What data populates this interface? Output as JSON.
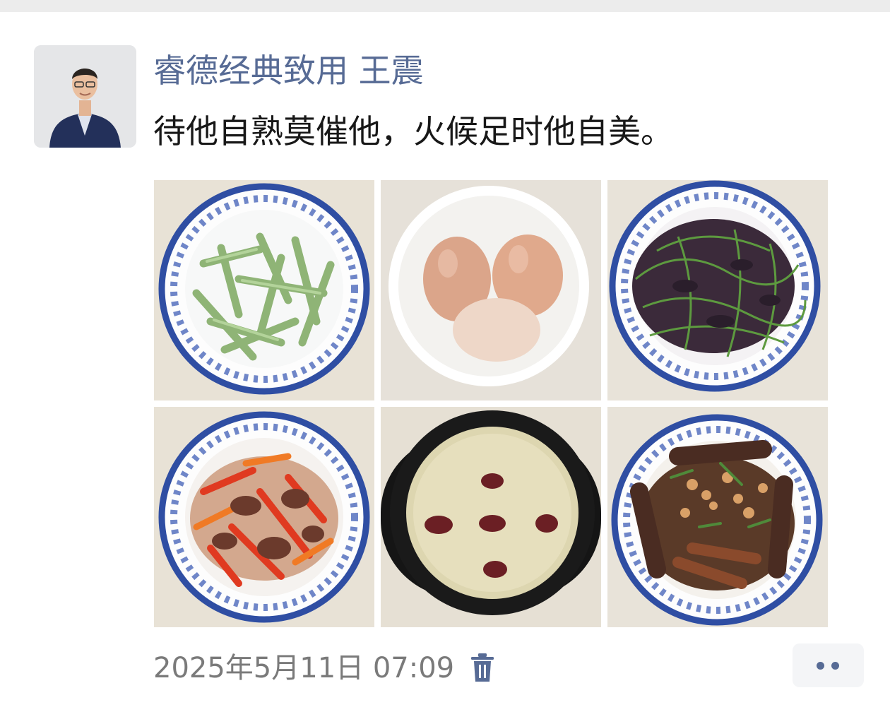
{
  "post": {
    "author": "睿德经典致用 王震",
    "text": "待他自熟莫催他，火候足时他自美。",
    "timestamp": "2025年5月11日 07:09"
  },
  "photos": [
    {
      "dish": "green beans"
    },
    {
      "dish": "boiled eggs"
    },
    {
      "dish": "stir-fried greens"
    },
    {
      "dish": "peppers with sausage"
    },
    {
      "dish": "millet porridge with red dates"
    },
    {
      "dish": "braised eggplant with chicken feet and peanuts"
    }
  ],
  "icons": {
    "delete": "trash-icon",
    "more": "more-dots-icon"
  },
  "colors": {
    "author": "#576b95",
    "text": "#181818",
    "time": "#7a7a7a"
  }
}
